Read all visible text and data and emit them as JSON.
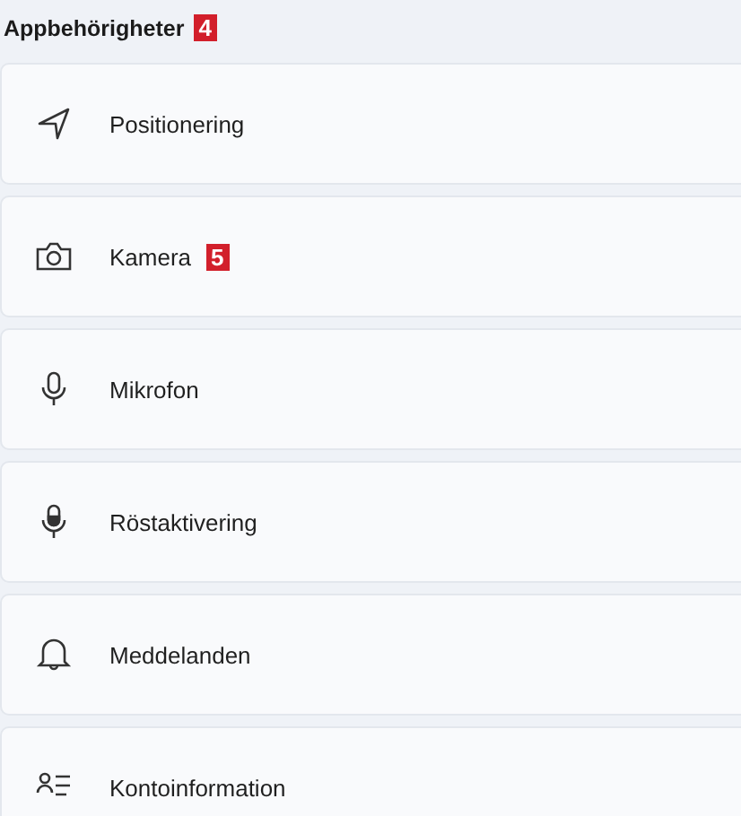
{
  "section": {
    "title": "Appbehörigheter",
    "badge": "4"
  },
  "items": [
    {
      "label": "Positionering"
    },
    {
      "label": "Kamera",
      "badge": "5"
    },
    {
      "label": "Mikrofon"
    },
    {
      "label": "Röstaktivering"
    },
    {
      "label": "Meddelanden"
    },
    {
      "label": "Kontoinformation"
    }
  ]
}
